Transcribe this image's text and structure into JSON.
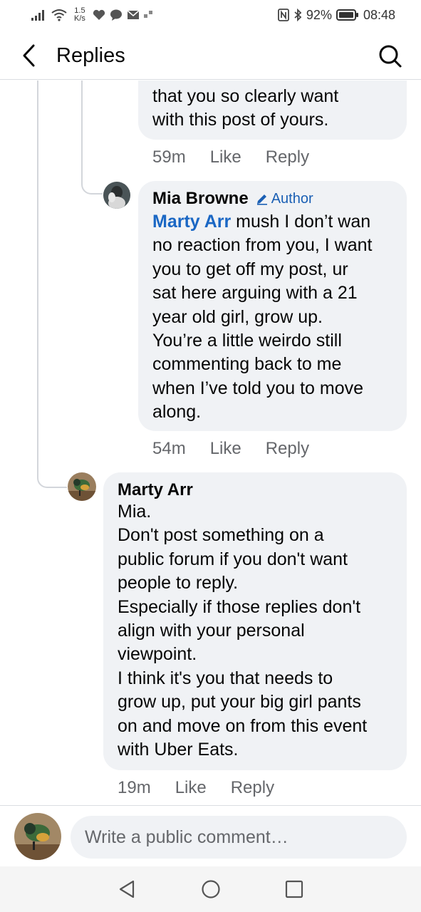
{
  "status_bar": {
    "net_speed_value": "1.5",
    "net_speed_unit": "K/s",
    "battery": "92%",
    "time": "08:48"
  },
  "nav": {
    "title": "Replies"
  },
  "comments": [
    {
      "text": "that you so clearly want\nwith this post of yours.",
      "time": "59m",
      "like": "Like",
      "reply": "Reply"
    },
    {
      "author": "Mia Browne",
      "badge": "Author",
      "mention": "Marty Arr",
      "text": " mush I don’t wan\nno reaction from you, I want\nyou to get off my post, ur\nsat here arguing with a 21\nyear old girl, grow up.\nYou’re a little weirdo still\ncommenting back to me\nwhen I’ve told you to move\nalong.",
      "time": "54m",
      "like": "Like",
      "reply": "Reply"
    },
    {
      "author": "Marty Arr",
      "text": "Mia.\nDon't post something on a\npublic forum if you don't want\npeople to reply.\nEspecially if those replies don't\nalign with your personal\nviewpoint.\nI think it's you that needs to\ngrow up, put your big girl pants\non and move on from this event\nwith Uber Eats.",
      "time": "19m",
      "like": "Like",
      "reply": "Reply"
    }
  ],
  "composer": {
    "placeholder": "Write a public comment…"
  },
  "colors": {
    "bubble": "#f0f2f5",
    "link": "#1a67c4",
    "meta": "#65676b"
  }
}
